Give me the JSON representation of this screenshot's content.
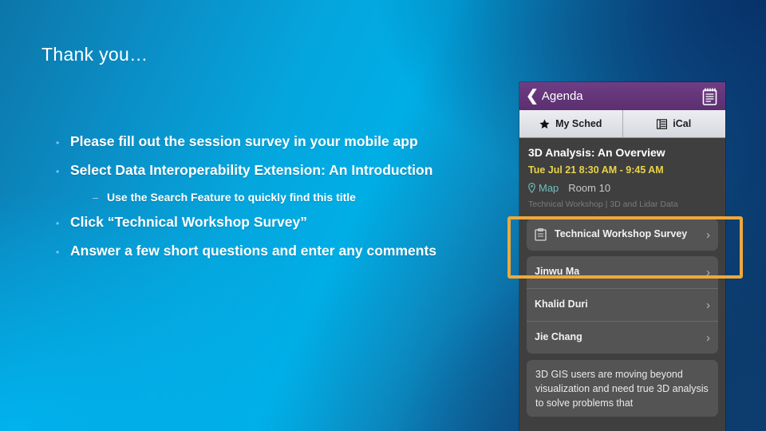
{
  "slide": {
    "title": "Thank you…",
    "bullets": [
      {
        "level": 1,
        "marker": "•",
        "text": "Please fill out the session survey in your mobile app"
      },
      {
        "level": 1,
        "marker": "•",
        "text": "Select Data Interoperability Extension: An Introduction"
      },
      {
        "level": 2,
        "marker": "–",
        "text": "Use the Search Feature to quickly find this title"
      },
      {
        "level": 1,
        "marker": "•",
        "text": "Click “Technical Workshop Survey”"
      },
      {
        "level": 1,
        "marker": "•",
        "text": "Answer a few short questions and enter any comments"
      }
    ]
  },
  "phone": {
    "nav": {
      "back_label": "Agenda",
      "back_icon": "chevron-left-icon",
      "notes_icon": "notepad-icon"
    },
    "segmented": [
      {
        "label": "My Sched",
        "icon": "star-icon"
      },
      {
        "label": "iCal",
        "icon": "calendar-list-icon"
      }
    ],
    "session": {
      "title": "3D Analysis: An Overview",
      "time": "Tue Jul 21 8:30 AM - 9:45 AM",
      "map_label": "Map",
      "map_icon": "map-pin-icon",
      "room": "Room 10",
      "track": "Technical Workshop | 3D and Lidar Data"
    },
    "survey_row": {
      "label": "Technical Workshop Survey",
      "icon": "survey-clipboard-icon",
      "chevron": "›"
    },
    "speakers": [
      {
        "name": "Jinwu Ma",
        "chevron": "›"
      },
      {
        "name": "Khalid Duri",
        "chevron": "›"
      },
      {
        "name": "Jie Chang",
        "chevron": "›"
      }
    ],
    "description": "3D GIS users are moving beyond visualization and need true 3D analysis to solve problems that"
  },
  "highlight": {
    "color": "#eda93c",
    "target": "Technical Workshop Survey"
  },
  "colors": {
    "background_start": "#0c76a8",
    "background_cyan": "#00aee6",
    "background_navy": "#0a3466",
    "nav_purple": "#5b2f70",
    "time_yellow": "#e8d34a",
    "map_teal": "#6fbfbd",
    "highlight_orange": "#eda93c"
  }
}
